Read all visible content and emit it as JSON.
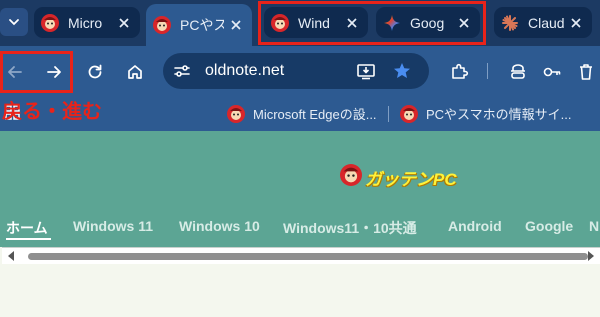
{
  "tabs": [
    {
      "title": "Micro",
      "favicon": "gatten-mascot-icon",
      "active": false
    },
    {
      "title": "PCやス",
      "favicon": "gatten-mascot-icon",
      "active": true
    },
    {
      "title": "Wind",
      "favicon": "gatten-mascot-icon",
      "active": false
    },
    {
      "title": "Goog",
      "favicon": "gemini-icon",
      "active": false
    },
    {
      "title": "Claud",
      "favicon": "claude-icon",
      "active": false
    }
  ],
  "toolbar": {
    "url": "oldnote.net",
    "icons": [
      "back-arrow-icon",
      "forward-arrow-icon",
      "reload-icon",
      "home-icon",
      "site-settings-icon",
      "install-app-icon",
      "favorite-star-icon",
      "extensions-icon",
      "copilot-icon",
      "password-key-icon",
      "trash-icon"
    ]
  },
  "annotation": {
    "nav_caption": "戻る・進む"
  },
  "bookmarks": [
    {
      "label": "Microsoft Edgeの設...",
      "favicon": "gatten-mascot-icon"
    },
    {
      "label": "PCやスマホの情報サイ...",
      "favicon": "gatten-mascot-icon"
    }
  ],
  "site": {
    "logo_text": "ガッテンPC",
    "nav": [
      "ホーム",
      "Windows 11",
      "Windows 10",
      "Windows11・10共通",
      "Android",
      "Google",
      "N"
    ]
  },
  "colors": {
    "tabstrip": "#1c3a63",
    "toolbar": "#2d5a91",
    "header": "#5ca594",
    "highlight": "#e8231a",
    "logo": "#fff23a"
  }
}
